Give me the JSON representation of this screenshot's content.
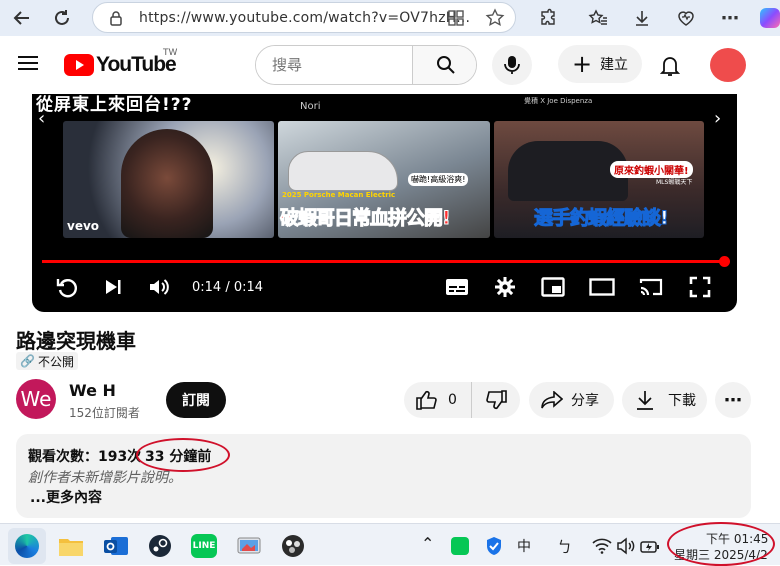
{
  "browser": {
    "url": "https://www.youtube.com/watch?v=OV7hzH..."
  },
  "youtube": {
    "logo_text": "YouTube",
    "region": "TW",
    "search_placeholder": "搜尋",
    "create_label": "建立"
  },
  "player": {
    "thumbnails": [
      {
        "caption": "從屏東上來回台!??",
        "badge": "vevo"
      },
      {
        "caption": "破蝦哥日常血拼公開!",
        "top_label": "Nori",
        "subtitle": "2025 Porsche Macan Electric",
        "bubble": "嚇跪!高級浴爽!"
      },
      {
        "caption": "選手釣蝦經驗談!",
        "top_label": "覺積 X Joe Dispenza",
        "bubble": "原來釣蝦小關華!",
        "tag": "MLS蝦戰天下"
      }
    ],
    "time": "0:14 / 0:14",
    "progress": 1.0
  },
  "video": {
    "title": "路邊突現機車",
    "privacy": "不公開"
  },
  "channel": {
    "avatar_text": "We",
    "name": "We H",
    "subscribers": "152位訂閱者",
    "subscribe_label": "訂閱"
  },
  "actions": {
    "likes": "0",
    "share": "分享",
    "download": "下載"
  },
  "description": {
    "views": "觀看次數：193次",
    "time_ago": "33 分鐘前",
    "empty_text": "創作者未新增影片說明。",
    "more": "...更多內容"
  },
  "taskbar": {
    "ime": "中",
    "time": "下午 01:45",
    "date": "星期三 2025/4/2"
  },
  "colors": {
    "youtube_red": "#ff0000",
    "annotation_red": "#d0112b",
    "avatar": "#c2185b"
  }
}
